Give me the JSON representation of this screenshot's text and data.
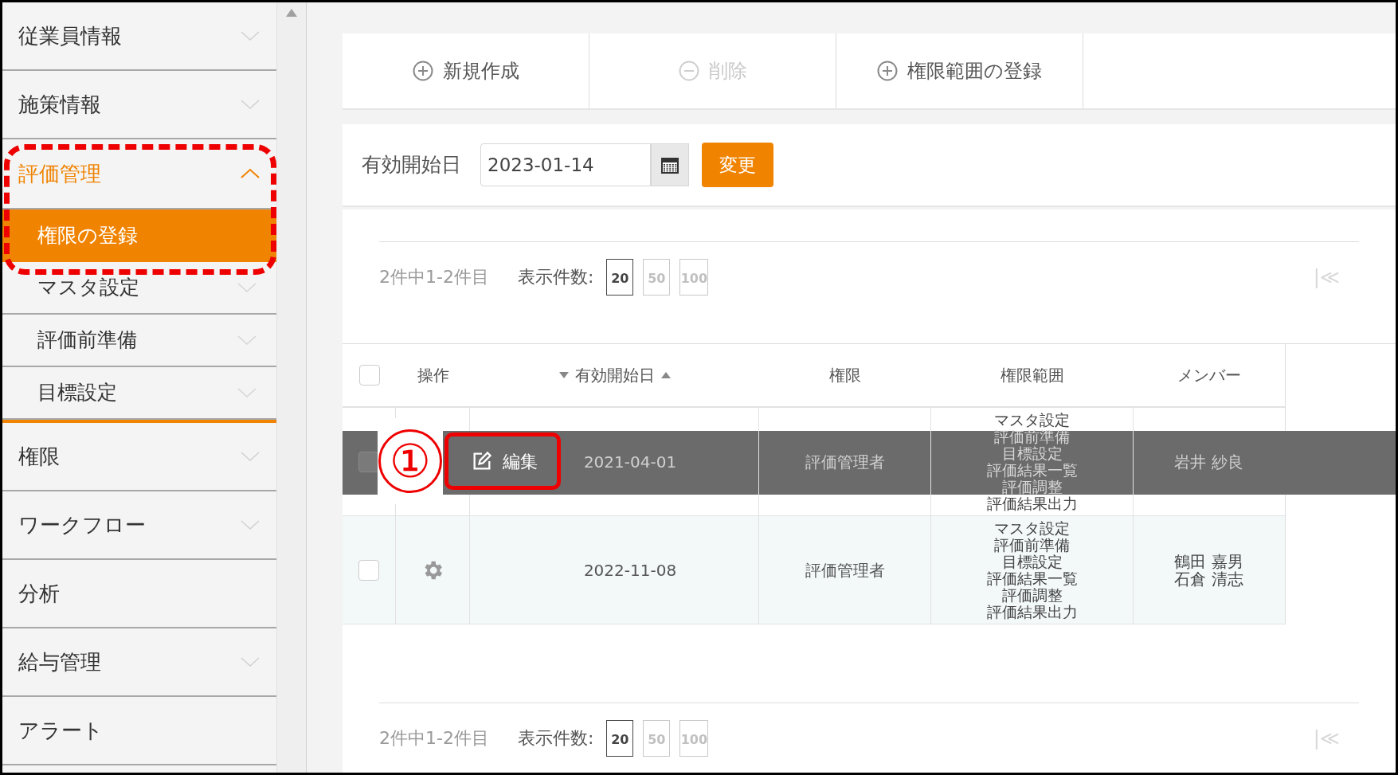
{
  "sidebar": {
    "items": [
      {
        "label": "従業員情報",
        "kind": "group",
        "expanded": false
      },
      {
        "label": "施策情報",
        "kind": "group",
        "expanded": false
      },
      {
        "label": "評価管理",
        "kind": "group",
        "expanded": true,
        "children": [
          {
            "label": "権限の登録",
            "kind": "link",
            "selected": true
          },
          {
            "label": "マスタ設定",
            "kind": "group",
            "selected": false
          },
          {
            "label": "評価前準備",
            "kind": "group",
            "selected": false
          },
          {
            "label": "目標設定",
            "kind": "group",
            "selected": false
          }
        ]
      },
      {
        "label": "権限",
        "kind": "group",
        "expanded": false
      },
      {
        "label": "ワークフロー",
        "kind": "group",
        "expanded": false
      },
      {
        "label": "分析",
        "kind": "link",
        "expanded": false
      },
      {
        "label": "給与管理",
        "kind": "group",
        "expanded": false
      },
      {
        "label": "アラート",
        "kind": "link",
        "expanded": false
      }
    ]
  },
  "toolbar": {
    "buttons": [
      {
        "label": "新規作成",
        "kind": "add",
        "disabled": false
      },
      {
        "label": "削除",
        "kind": "remove",
        "disabled": true
      },
      {
        "label": "権限範囲の登録",
        "kind": "add",
        "disabled": false
      }
    ]
  },
  "date_filter": {
    "label": "有効開始日",
    "value": "2023-01-14",
    "button": "変更"
  },
  "pager_top": {
    "summary": "2件中1-2件目",
    "page_size_label": "表示件数:",
    "sizes": [
      {
        "label": "20",
        "selected": true
      },
      {
        "label": "50",
        "selected": false
      },
      {
        "label": "100",
        "selected": false
      }
    ],
    "first_page": "|≪"
  },
  "table": {
    "select_all": {
      "checked": false
    },
    "columns": [
      {
        "label": "操作",
        "kind": "plain"
      },
      {
        "label": "有効開始日",
        "kind": "sortable"
      },
      {
        "label": "権限",
        "kind": "plain"
      },
      {
        "label": "権限範囲",
        "kind": "plain"
      },
      {
        "label": "メンバー",
        "kind": "plain"
      }
    ],
    "rows": [
      {
        "checked": false,
        "hovered": true,
        "action_label": "編集",
        "date": "2021-04-01",
        "role": "評価管理者",
        "scopes": [
          "マスタ設定",
          "評価前準備",
          "目標設定",
          "評価結果一覧",
          "評価調整",
          "評価結果出力"
        ],
        "members": [
          "岩井 紗良"
        ]
      },
      {
        "checked": false,
        "hovered": false,
        "date": "2022-11-08",
        "role": "評価管理者",
        "scopes": [
          "マスタ設定",
          "評価前準備",
          "目標設定",
          "評価結果一覧",
          "評価調整",
          "評価結果出力"
        ],
        "members": [
          "鶴田 嘉男",
          "石倉 清志"
        ]
      }
    ]
  },
  "pager_bottom": {
    "summary": "2件中1-2件目",
    "page_size_label": "表示件数:",
    "sizes": [
      {
        "label": "20",
        "selected": true
      },
      {
        "label": "50",
        "selected": false
      },
      {
        "label": "100",
        "selected": false
      }
    ],
    "first_page": "|≪"
  },
  "annotations": {
    "callout": "①"
  }
}
